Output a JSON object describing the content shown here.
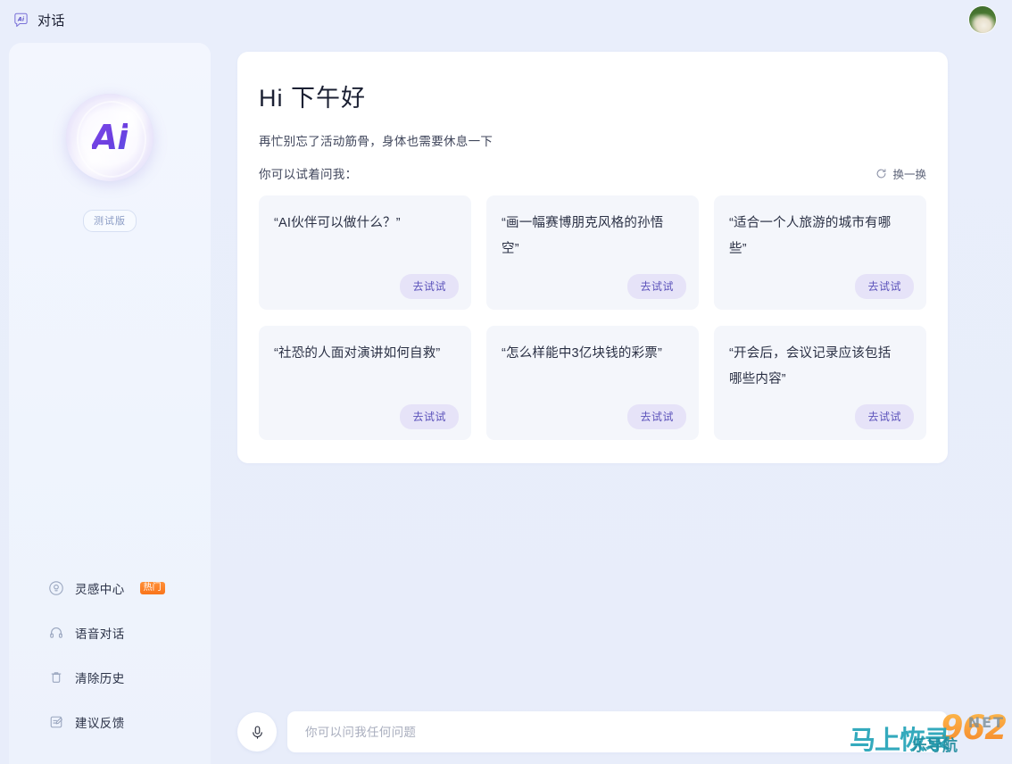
{
  "topbar": {
    "title": "对话",
    "brand_icon": "ai-chat-icon",
    "avatar_label": "用户头像"
  },
  "sidebar": {
    "logo_text": "Ai",
    "badge": "测试版",
    "menu": [
      {
        "label": "灵感中心",
        "icon": "lightbulb-icon",
        "badge": "热门"
      },
      {
        "label": "语音对话",
        "icon": "headphones-icon",
        "badge": ""
      },
      {
        "label": "清除历史",
        "icon": "trash-icon",
        "badge": ""
      },
      {
        "label": "建议反馈",
        "icon": "feedback-icon",
        "badge": ""
      }
    ]
  },
  "greeting": {
    "title": "Hi 下午好",
    "subtitle": "再忙别忘了活动筋骨，身体也需要休息一下",
    "hint": "你可以试着问我：",
    "refresh_label": "换一换",
    "refresh_icon": "refresh-icon"
  },
  "suggestions": {
    "try_label": "去试试",
    "items": [
      {
        "text": "“AI伙伴可以做什么？”"
      },
      {
        "text": "“画一幅赛博朋克风格的孙悟空”"
      },
      {
        "text": "“适合一个人旅游的城市有哪些”"
      },
      {
        "text": "“社恐的人面对演讲如何自救”"
      },
      {
        "text": "“怎么样能中3亿块钱的彩票”"
      },
      {
        "text": "“开会后，会议记录应该包括哪些内容”"
      }
    ]
  },
  "composer": {
    "mic_icon": "microphone-icon",
    "placeholder": "你可以问我任何问题",
    "value": ""
  },
  "watermark": {
    "number": "962",
    "net": "NET",
    "cn_main": "马上恢录",
    "cn_sub": "乐导航"
  },
  "colors": {
    "accent_purple": "#5c53bb",
    "hot_orange": "#f9741b",
    "page_bg": "#e9eefb",
    "card_bg": "#f4f6fb"
  }
}
